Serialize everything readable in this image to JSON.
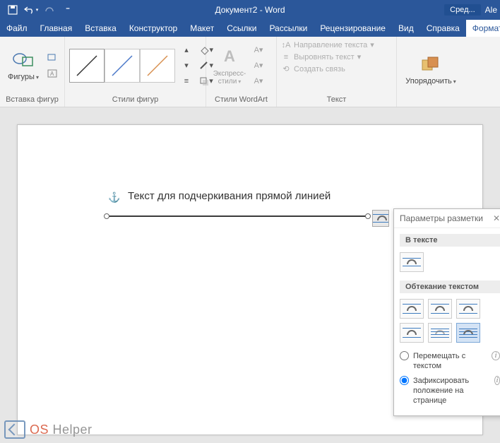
{
  "titlebar": {
    "title": "Документ2 - Word",
    "tools_label": "Сред...",
    "user": "Ale"
  },
  "tabs": {
    "file": "Файл",
    "items": [
      "Главная",
      "Вставка",
      "Конструктор",
      "Макет",
      "Ссылки",
      "Рассылки",
      "Рецензирование",
      "Вид",
      "Справка"
    ],
    "format": "Формат"
  },
  "ribbon": {
    "shapes_group": "Вставка фигур",
    "shapes_btn": "Фигуры",
    "styles_group": "Стили фигур",
    "wordart_group": "Стили WordArt",
    "wordart_btn": "Экспресс-стили",
    "text_group": "Текст",
    "text_direction": "Направление текста",
    "align_text": "Выровнять текст",
    "create_link": "Создать связь",
    "arrange_group": "",
    "arrange_btn": "Упорядочить"
  },
  "document": {
    "text": "Текст для подчеркивания прямой линией"
  },
  "popup": {
    "title": "Параметры разметки",
    "section_inline": "В тексте",
    "section_wrap": "Обтекание текстом",
    "radio_move": "Перемещать с текстом",
    "radio_fix": "Зафиксировать положение на странице"
  },
  "watermark": {
    "brand1": "OS",
    "brand2": "Helper"
  }
}
